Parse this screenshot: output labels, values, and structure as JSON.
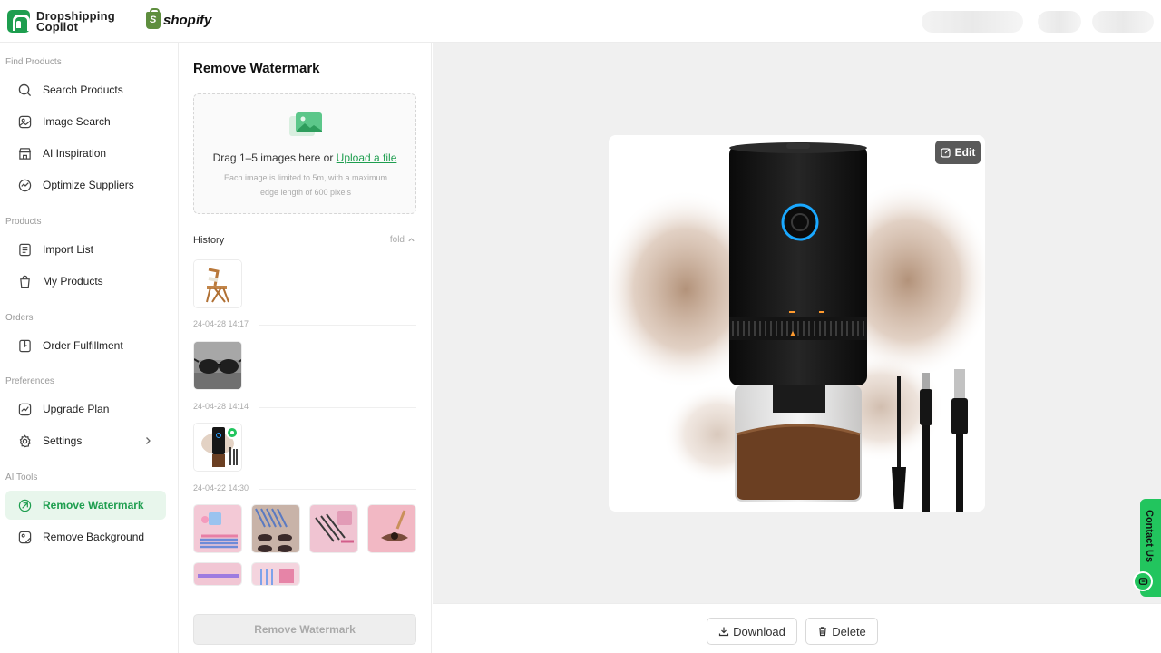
{
  "header": {
    "brand_line1": "Dropshipping",
    "brand_line2": "Copilot",
    "partner": "shopify",
    "brand_color": "#1e9e4f"
  },
  "sidebar": {
    "sections": [
      {
        "title": "Find Products",
        "items": [
          {
            "label": "Search Products",
            "icon": "search-icon"
          },
          {
            "label": "Image Search",
            "icon": "image-icon"
          },
          {
            "label": "AI Inspiration",
            "icon": "store-icon"
          },
          {
            "label": "Optimize Suppliers",
            "icon": "optimize-icon"
          }
        ]
      },
      {
        "title": "Products",
        "items": [
          {
            "label": "Import List",
            "icon": "list-icon"
          },
          {
            "label": "My Products",
            "icon": "bag-icon"
          }
        ]
      },
      {
        "title": "Orders",
        "items": [
          {
            "label": "Order Fulfillment",
            "icon": "fulfillment-icon"
          }
        ]
      },
      {
        "title": "Preferences",
        "items": [
          {
            "label": "Upgrade Plan",
            "icon": "upgrade-icon"
          },
          {
            "label": "Settings",
            "icon": "gear-icon"
          }
        ]
      },
      {
        "title": "AI Tools",
        "items": [
          {
            "label": "Remove Watermark",
            "icon": "watermark-icon",
            "active": true
          },
          {
            "label": "Remove Background",
            "icon": "background-icon"
          }
        ]
      }
    ]
  },
  "panel": {
    "title": "Remove Watermark",
    "drop_text": "Drag 1–5 images here or ",
    "upload_link": "Upload a file",
    "drop_hint": "Each image is limited to 5m, with a maximum edge length of 600 pixels",
    "history_label": "History",
    "fold_label": "fold",
    "history": [
      {
        "date": "24-04-28 14:17",
        "thumb": "folding-chair"
      },
      {
        "date": "24-04-28 14:14",
        "thumb": "sunglasses"
      },
      {
        "date": "24-04-22 14:30",
        "thumb": "coffee-grinder",
        "selected": true
      }
    ],
    "more_thumbs": [
      "makeup-brushes",
      "eyeshadow-palette",
      "cosmetic-pencils",
      "eyeliner",
      "makeup-kit",
      "brush-set"
    ],
    "action_button": "Remove Watermark"
  },
  "canvas": {
    "edit_label": "Edit",
    "download_label": "Download",
    "delete_label": "Delete",
    "image_subject": "electric coffee grinder"
  },
  "contact": {
    "label": "Contact Us"
  }
}
